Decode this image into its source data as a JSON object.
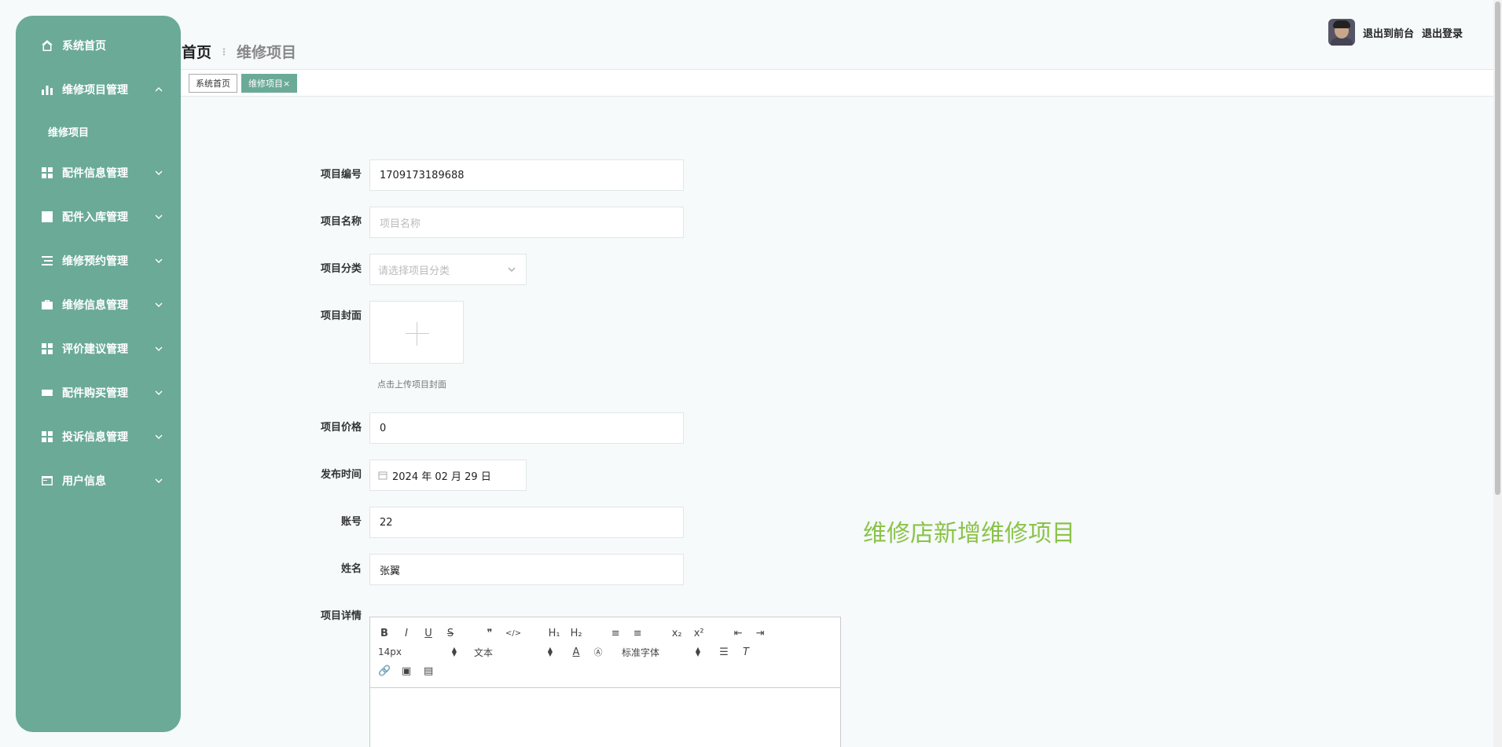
{
  "sidebar": {
    "items": [
      {
        "label": "系统首页",
        "icon": "home-icon"
      },
      {
        "label": "维修项目管理",
        "icon": "bar-chart-icon",
        "expanded": true,
        "children": [
          {
            "label": "维修项目"
          }
        ]
      },
      {
        "label": "配件信息管理",
        "icon": "grid-icon"
      },
      {
        "label": "配件入库管理",
        "icon": "trend-icon"
      },
      {
        "label": "维修预约管理",
        "icon": "list-icon"
      },
      {
        "label": "维修信息管理",
        "icon": "briefcase-icon"
      },
      {
        "label": "评价建议管理",
        "icon": "grid-icon"
      },
      {
        "label": "配件购买管理",
        "icon": "ticket-icon"
      },
      {
        "label": "投诉信息管理",
        "icon": "grid-icon"
      },
      {
        "label": "用户信息",
        "icon": "card-icon"
      }
    ]
  },
  "header": {
    "title": "首页",
    "separator": "⋮",
    "subtitle": "维修项目"
  },
  "topright": {
    "front": "退出到前台",
    "logout": "退出登录"
  },
  "tabs": [
    {
      "label": "系统首页",
      "active": false
    },
    {
      "label": "维修项目×",
      "active": true
    }
  ],
  "form": {
    "code": {
      "label": "项目编号",
      "value": "1709173189688"
    },
    "name": {
      "label": "项目名称",
      "placeholder": "项目名称"
    },
    "category": {
      "label": "项目分类",
      "placeholder": "请选择项目分类"
    },
    "cover": {
      "label": "项目封面",
      "tip": "点击上传项目封面"
    },
    "price": {
      "label": "项目价格",
      "value": "0"
    },
    "publish": {
      "label": "发布时间",
      "value": "2024 年 02 月 29 日"
    },
    "account": {
      "label": "账号",
      "value": "22"
    },
    "person": {
      "label": "姓名",
      "value": "张翼"
    },
    "detail": {
      "label": "项目详情"
    }
  },
  "editor": {
    "row1": [
      "B",
      "I",
      "U",
      "S",
      "❞",
      "</>",
      "H₁",
      "H₂",
      "≡",
      "≡",
      "x₂",
      "x²",
      "⇤",
      "⇥"
    ],
    "size": "14px",
    "format": "文本",
    "font": "标准字体"
  },
  "overlay": {
    "caption": "维修店新增维修项目"
  },
  "colors": {
    "sidebar": "#6aaa96",
    "accent": "#6aaa96",
    "caption": "#8bc34a"
  }
}
